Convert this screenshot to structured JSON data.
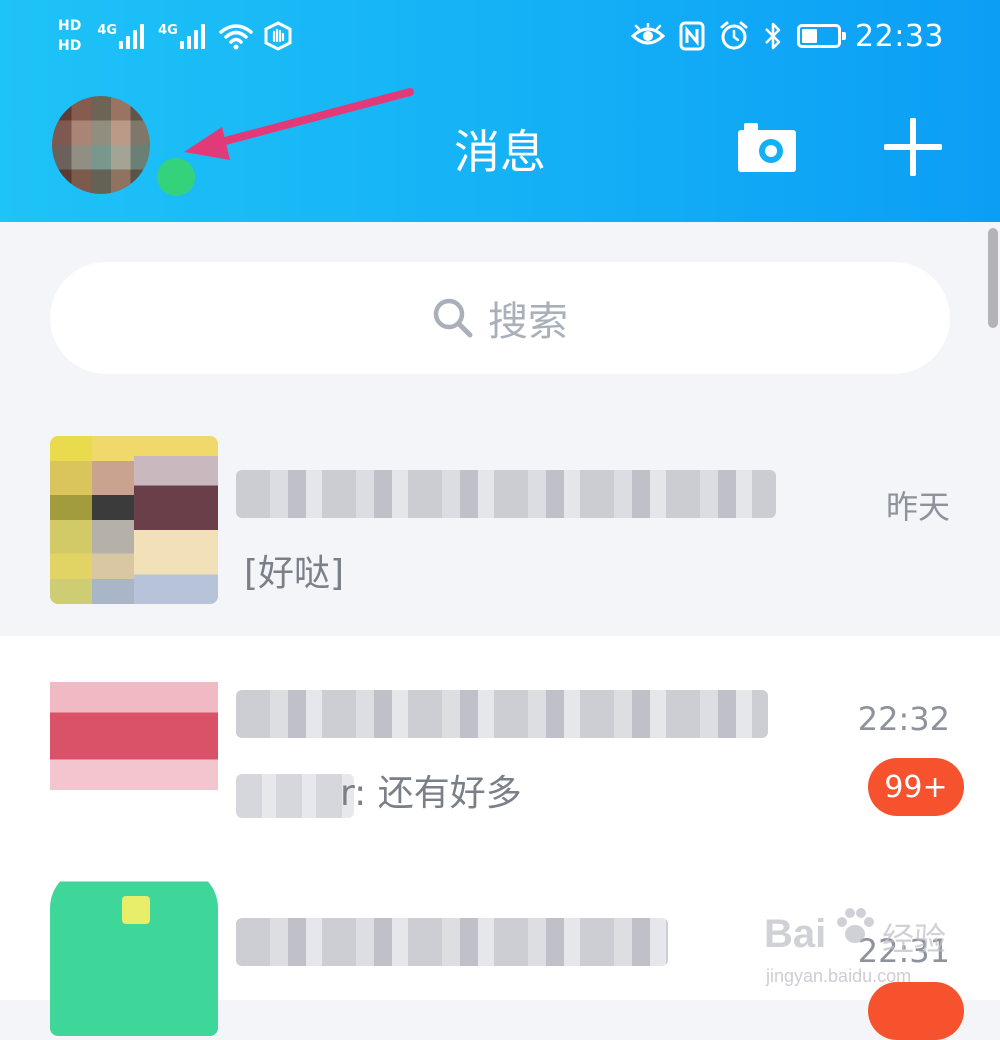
{
  "status_bar": {
    "hd1": "HD",
    "hd2": "HD",
    "signal1_label": "4G",
    "signal2_label": "4G",
    "time": "22:33",
    "icons": [
      "wifi-icon",
      "hotspot-icon",
      "eye-comfort-icon",
      "nfc-icon",
      "alarm-icon",
      "bluetooth-icon",
      "battery-icon"
    ],
    "battery_level": 0.45
  },
  "header": {
    "title": "消息",
    "avatar_status": "online",
    "online_color": "#34d37b",
    "gradient": [
      "#1ec3f7",
      "#0c9ef5"
    ],
    "annotation_color": "#e23a78",
    "actions": [
      "camera-icon",
      "plus-icon"
    ]
  },
  "search": {
    "placeholder": "搜索",
    "icon": "search-icon"
  },
  "conversations": [
    {
      "name": "",
      "preview": "[好哒]",
      "time": "昨天",
      "unread": ""
    },
    {
      "name": "",
      "preview": "r: 还有好多",
      "time": "22:32",
      "unread": "99+"
    },
    {
      "name": "",
      "preview": "",
      "time": "22:31",
      "unread": ""
    }
  ],
  "badge_color": "#f5522d",
  "watermark": {
    "logo": "Bai",
    "text": "经验",
    "url": "jingyan.baidu.com"
  }
}
